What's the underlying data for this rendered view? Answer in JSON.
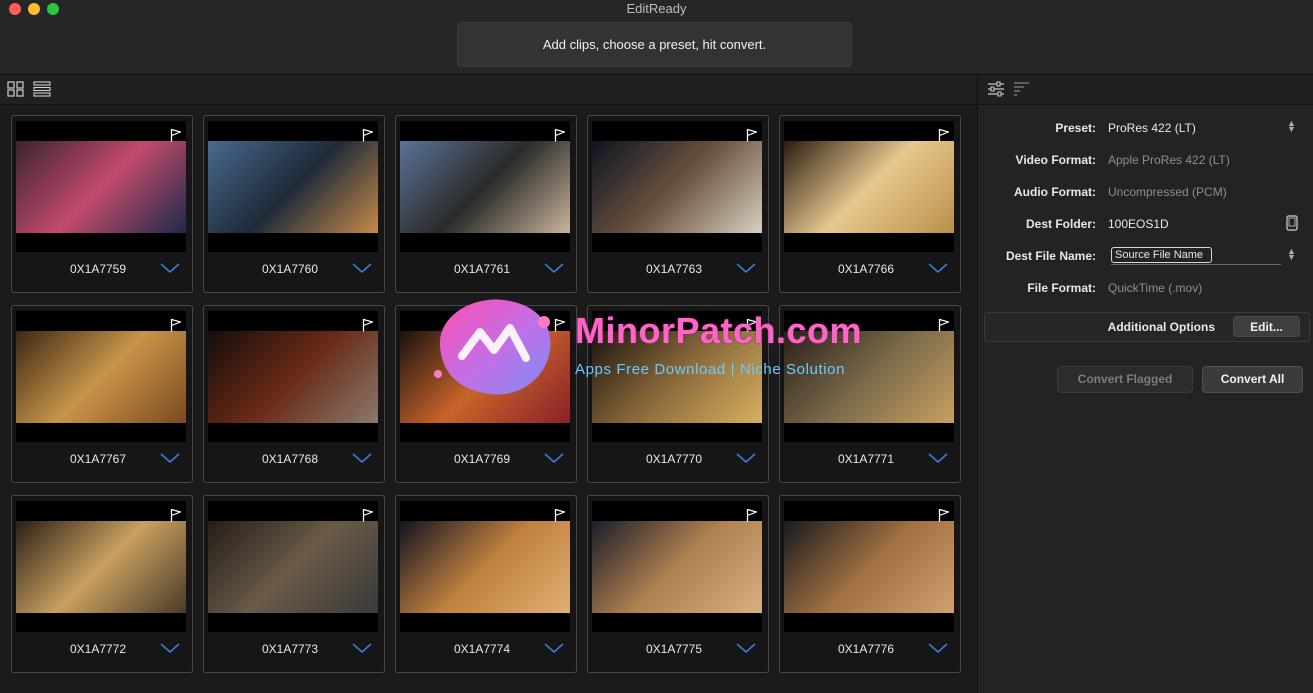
{
  "window": {
    "title": "EditReady"
  },
  "hint": "Add clips, choose a preset, hit convert.",
  "toolbar": {
    "grid_icon": "grid-view-icon",
    "list_icon": "list-view-icon"
  },
  "clips": [
    {
      "name": "0X1A7759",
      "flagged": false
    },
    {
      "name": "0X1A7760",
      "flagged": false
    },
    {
      "name": "0X1A7761",
      "flagged": false
    },
    {
      "name": "0X1A7763",
      "flagged": false
    },
    {
      "name": "0X1A7766",
      "flagged": false
    },
    {
      "name": "0X1A7767",
      "flagged": false
    },
    {
      "name": "0X1A7768",
      "flagged": false
    },
    {
      "name": "0X1A7769",
      "flagged": false
    },
    {
      "name": "0X1A7770",
      "flagged": false
    },
    {
      "name": "0X1A7771",
      "flagged": false
    },
    {
      "name": "0X1A7772",
      "flagged": false
    },
    {
      "name": "0X1A7773",
      "flagged": false
    },
    {
      "name": "0X1A7774",
      "flagged": false
    },
    {
      "name": "0X1A7775",
      "flagged": false
    },
    {
      "name": "0X1A7776",
      "flagged": false
    }
  ],
  "settings": {
    "preset_label": "Preset:",
    "preset_value": "ProRes 422 (LT)",
    "video_format_label": "Video Format:",
    "video_format_value": "Apple ProRes 422 (LT)",
    "audio_format_label": "Audio Format:",
    "audio_format_value": "Uncompressed (PCM)",
    "dest_folder_label": "Dest Folder:",
    "dest_folder_value": "100EOS1D",
    "dest_file_name_label": "Dest File Name:",
    "dest_file_name_value": "Source File Name",
    "file_format_label": "File Format:",
    "file_format_value": "QuickTime (.mov)"
  },
  "additional_options": {
    "label": "Additional Options",
    "edit_button": "Edit..."
  },
  "actions": {
    "convert_flagged": "Convert Flagged",
    "convert_all": "Convert All"
  },
  "watermark": {
    "title": "MinorPatch.com",
    "subtitle": "Apps Free Download | Niche Solution"
  },
  "colors": {
    "accent_chevron": "#3a7bd5",
    "watermark_pink": "#ff64c8",
    "watermark_blue": "#6ec9ff"
  }
}
